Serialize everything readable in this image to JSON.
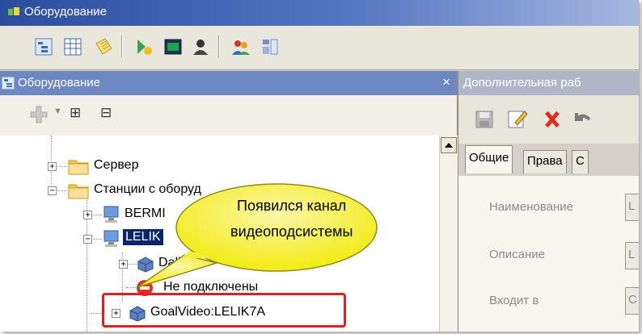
{
  "window": {
    "title": "Оборудование"
  },
  "toolbar": {
    "icons": [
      "tree-view-icon",
      "grid-view-icon",
      "notes-icon",
      "run-script-icon",
      "terminal-icon",
      "user-icon",
      "users-icon",
      "schema-icon"
    ]
  },
  "left_panel": {
    "title": "Оборудование",
    "close_glyph": "×",
    "tool_expand": "⊞",
    "tool_collapse": "⊟",
    "tree": [
      {
        "label": "Сервер"
      },
      {
        "label": "Станции с оборуд"
      },
      {
        "label": "BERMI"
      },
      {
        "label": "LELIK"
      },
      {
        "label": "Dallo"
      },
      {
        "label": "Не подключены"
      },
      {
        "label": "GoalVideo:LELIK7A"
      }
    ]
  },
  "callout": {
    "line1": "Появился канал",
    "line2": "видеоподсистемы"
  },
  "right_panel": {
    "title": "Дополнительная раб",
    "tabs": [
      "Общие",
      "Права",
      "С"
    ],
    "fields": [
      {
        "label": "Наименование",
        "value": "L"
      },
      {
        "label": "Описание",
        "value": "L"
      },
      {
        "label": "Входит в",
        "value": "С"
      }
    ]
  },
  "colors": {
    "accent": "#6d87c3",
    "highlight": "#e02020",
    "callout_fill": "#f2ec1a"
  }
}
